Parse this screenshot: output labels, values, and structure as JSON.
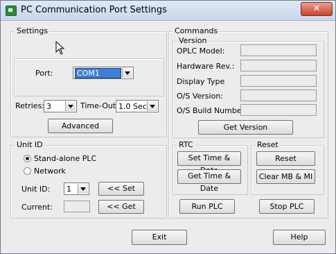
{
  "window": {
    "title": "PC Communication Port Settings",
    "close_symbol": "✕"
  },
  "settings": {
    "legend": "Settings",
    "port_label": "Port:",
    "port_value": "COM1",
    "retries_label": "Retries:",
    "retries_value": "3",
    "timeout_label": "Time-Out:",
    "timeout_value": "1.0 Sec",
    "advanced_label": "Advanced"
  },
  "unit_id": {
    "legend": "Unit ID",
    "standalone_label": "Stand-alone PLC",
    "network_label": "Network",
    "selected": "Stand-alone PLC",
    "unit_id_label": "Unit ID:",
    "unit_id_value": "1",
    "set_label": "<< Set",
    "current_label": "Current:",
    "current_value": "",
    "get_label": "<< Get"
  },
  "commands": {
    "legend": "Commands",
    "version": {
      "legend": "Version",
      "fields": [
        {
          "label": "OPLC Model:",
          "value": ""
        },
        {
          "label": "Hardware Rev.:",
          "value": ""
        },
        {
          "label": "Display Type",
          "value": ""
        },
        {
          "label": "O/S Version:",
          "value": ""
        },
        {
          "label": "O/S Build Number:",
          "value": ""
        }
      ],
      "get_version_label": "Get Version"
    },
    "rtc": {
      "legend": "RTC",
      "set_label": "Set Time & Date",
      "get_label": "Get Time & Date"
    },
    "reset": {
      "legend": "Reset",
      "reset_label": "Reset",
      "clear_label": "Clear MB & MI"
    },
    "run_label": "Run PLC",
    "stop_label": "Stop PLC"
  },
  "footer": {
    "exit_label": "Exit",
    "help_label": "Help"
  },
  "colors": {
    "selection": "#3d7fd6",
    "close_button": "#c9432b",
    "app_icon": "#2e8b3a"
  }
}
